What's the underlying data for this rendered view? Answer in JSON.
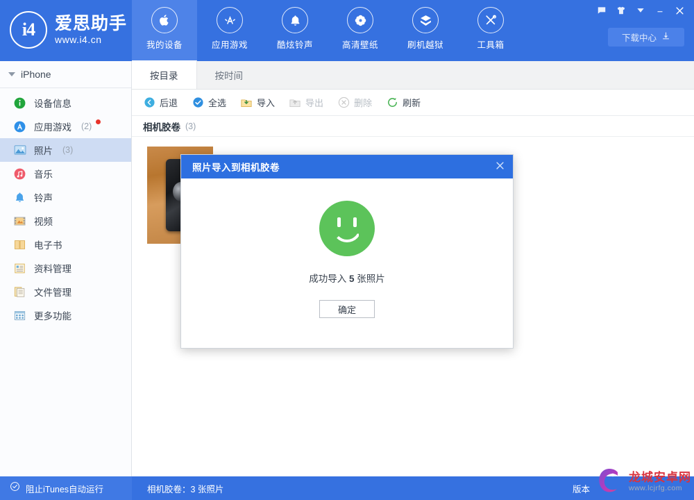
{
  "header": {
    "brand_mark": "i4",
    "brand_title": "爱思助手",
    "brand_sub": "www.i4.cn",
    "nav": [
      {
        "label": "我的设备",
        "icon": "apple-icon",
        "active": true
      },
      {
        "label": "应用游戏",
        "icon": "appstore-icon",
        "active": false
      },
      {
        "label": "酷炫铃声",
        "icon": "bell-icon",
        "active": false
      },
      {
        "label": "高清壁纸",
        "icon": "flower-icon",
        "active": false
      },
      {
        "label": "刷机越狱",
        "icon": "flash-box-icon",
        "active": false
      },
      {
        "label": "工具箱",
        "icon": "tools-icon",
        "active": false
      }
    ],
    "window_buttons": [
      {
        "name": "message-icon"
      },
      {
        "name": "skin-icon"
      },
      {
        "name": "chevron-down-icon"
      },
      {
        "name": "minimize-icon"
      },
      {
        "name": "close-icon"
      }
    ],
    "download_center_label": "下载中心"
  },
  "sidebar": {
    "device_name": "iPhone",
    "items": [
      {
        "label": "设备信息",
        "count": "",
        "icon": "info-icon",
        "selected": false,
        "dot": false
      },
      {
        "label": "应用游戏",
        "count": "(2)",
        "icon": "appstore-icon",
        "selected": false,
        "dot": true
      },
      {
        "label": "照片",
        "count": "(3)",
        "icon": "photo-icon",
        "selected": true,
        "dot": false
      },
      {
        "label": "音乐",
        "count": "",
        "icon": "music-icon",
        "selected": false,
        "dot": false
      },
      {
        "label": "铃声",
        "count": "",
        "icon": "ringtone-icon",
        "selected": false,
        "dot": false
      },
      {
        "label": "视频",
        "count": "",
        "icon": "video-icon",
        "selected": false,
        "dot": false
      },
      {
        "label": "电子书",
        "count": "",
        "icon": "book-icon",
        "selected": false,
        "dot": false
      },
      {
        "label": "资料管理",
        "count": "",
        "icon": "data-icon",
        "selected": false,
        "dot": false
      },
      {
        "label": "文件管理",
        "count": "",
        "icon": "file-icon",
        "selected": false,
        "dot": false
      },
      {
        "label": "更多功能",
        "count": "",
        "icon": "grid-icon",
        "selected": false,
        "dot": false
      }
    ]
  },
  "content": {
    "tabs": [
      {
        "label": "按目录",
        "active": true
      },
      {
        "label": "按时间",
        "active": false
      }
    ],
    "toolbar": [
      {
        "label": "后退",
        "icon": "back-icon",
        "disabled": false
      },
      {
        "label": "全选",
        "icon": "check-circle-icon",
        "disabled": false
      },
      {
        "label": "导入",
        "icon": "import-icon",
        "disabled": false
      },
      {
        "label": "导出",
        "icon": "export-icon",
        "disabled": true
      },
      {
        "label": "删除",
        "icon": "delete-icon",
        "disabled": true
      },
      {
        "label": "刷新",
        "icon": "refresh-icon",
        "disabled": false
      }
    ],
    "section_title": "相机胶卷",
    "section_count": "(3)"
  },
  "dialog": {
    "title": "照片导入到相机胶卷",
    "icon": "smiley-face-icon",
    "message_prefix": "成功导入 ",
    "message_count": "5",
    "message_suffix": " 张照片",
    "ok_label": "确定",
    "close_label": "×"
  },
  "statusbar": {
    "itunes_label": "阻止iTunes自动运行",
    "info": "相机胶卷：3 张照片",
    "version": "版本"
  },
  "watermark": {
    "main": "龙城安卓网",
    "sub": "www.lcjrfg.com"
  },
  "colors": {
    "brand_blue": "#3671e0",
    "nav_active": "#4e83e8",
    "sidebar_selected": "#cedcf3",
    "dialog_header": "#2d6fe0",
    "success_green": "#5cc35a",
    "badge_red": "#e8332b"
  }
}
